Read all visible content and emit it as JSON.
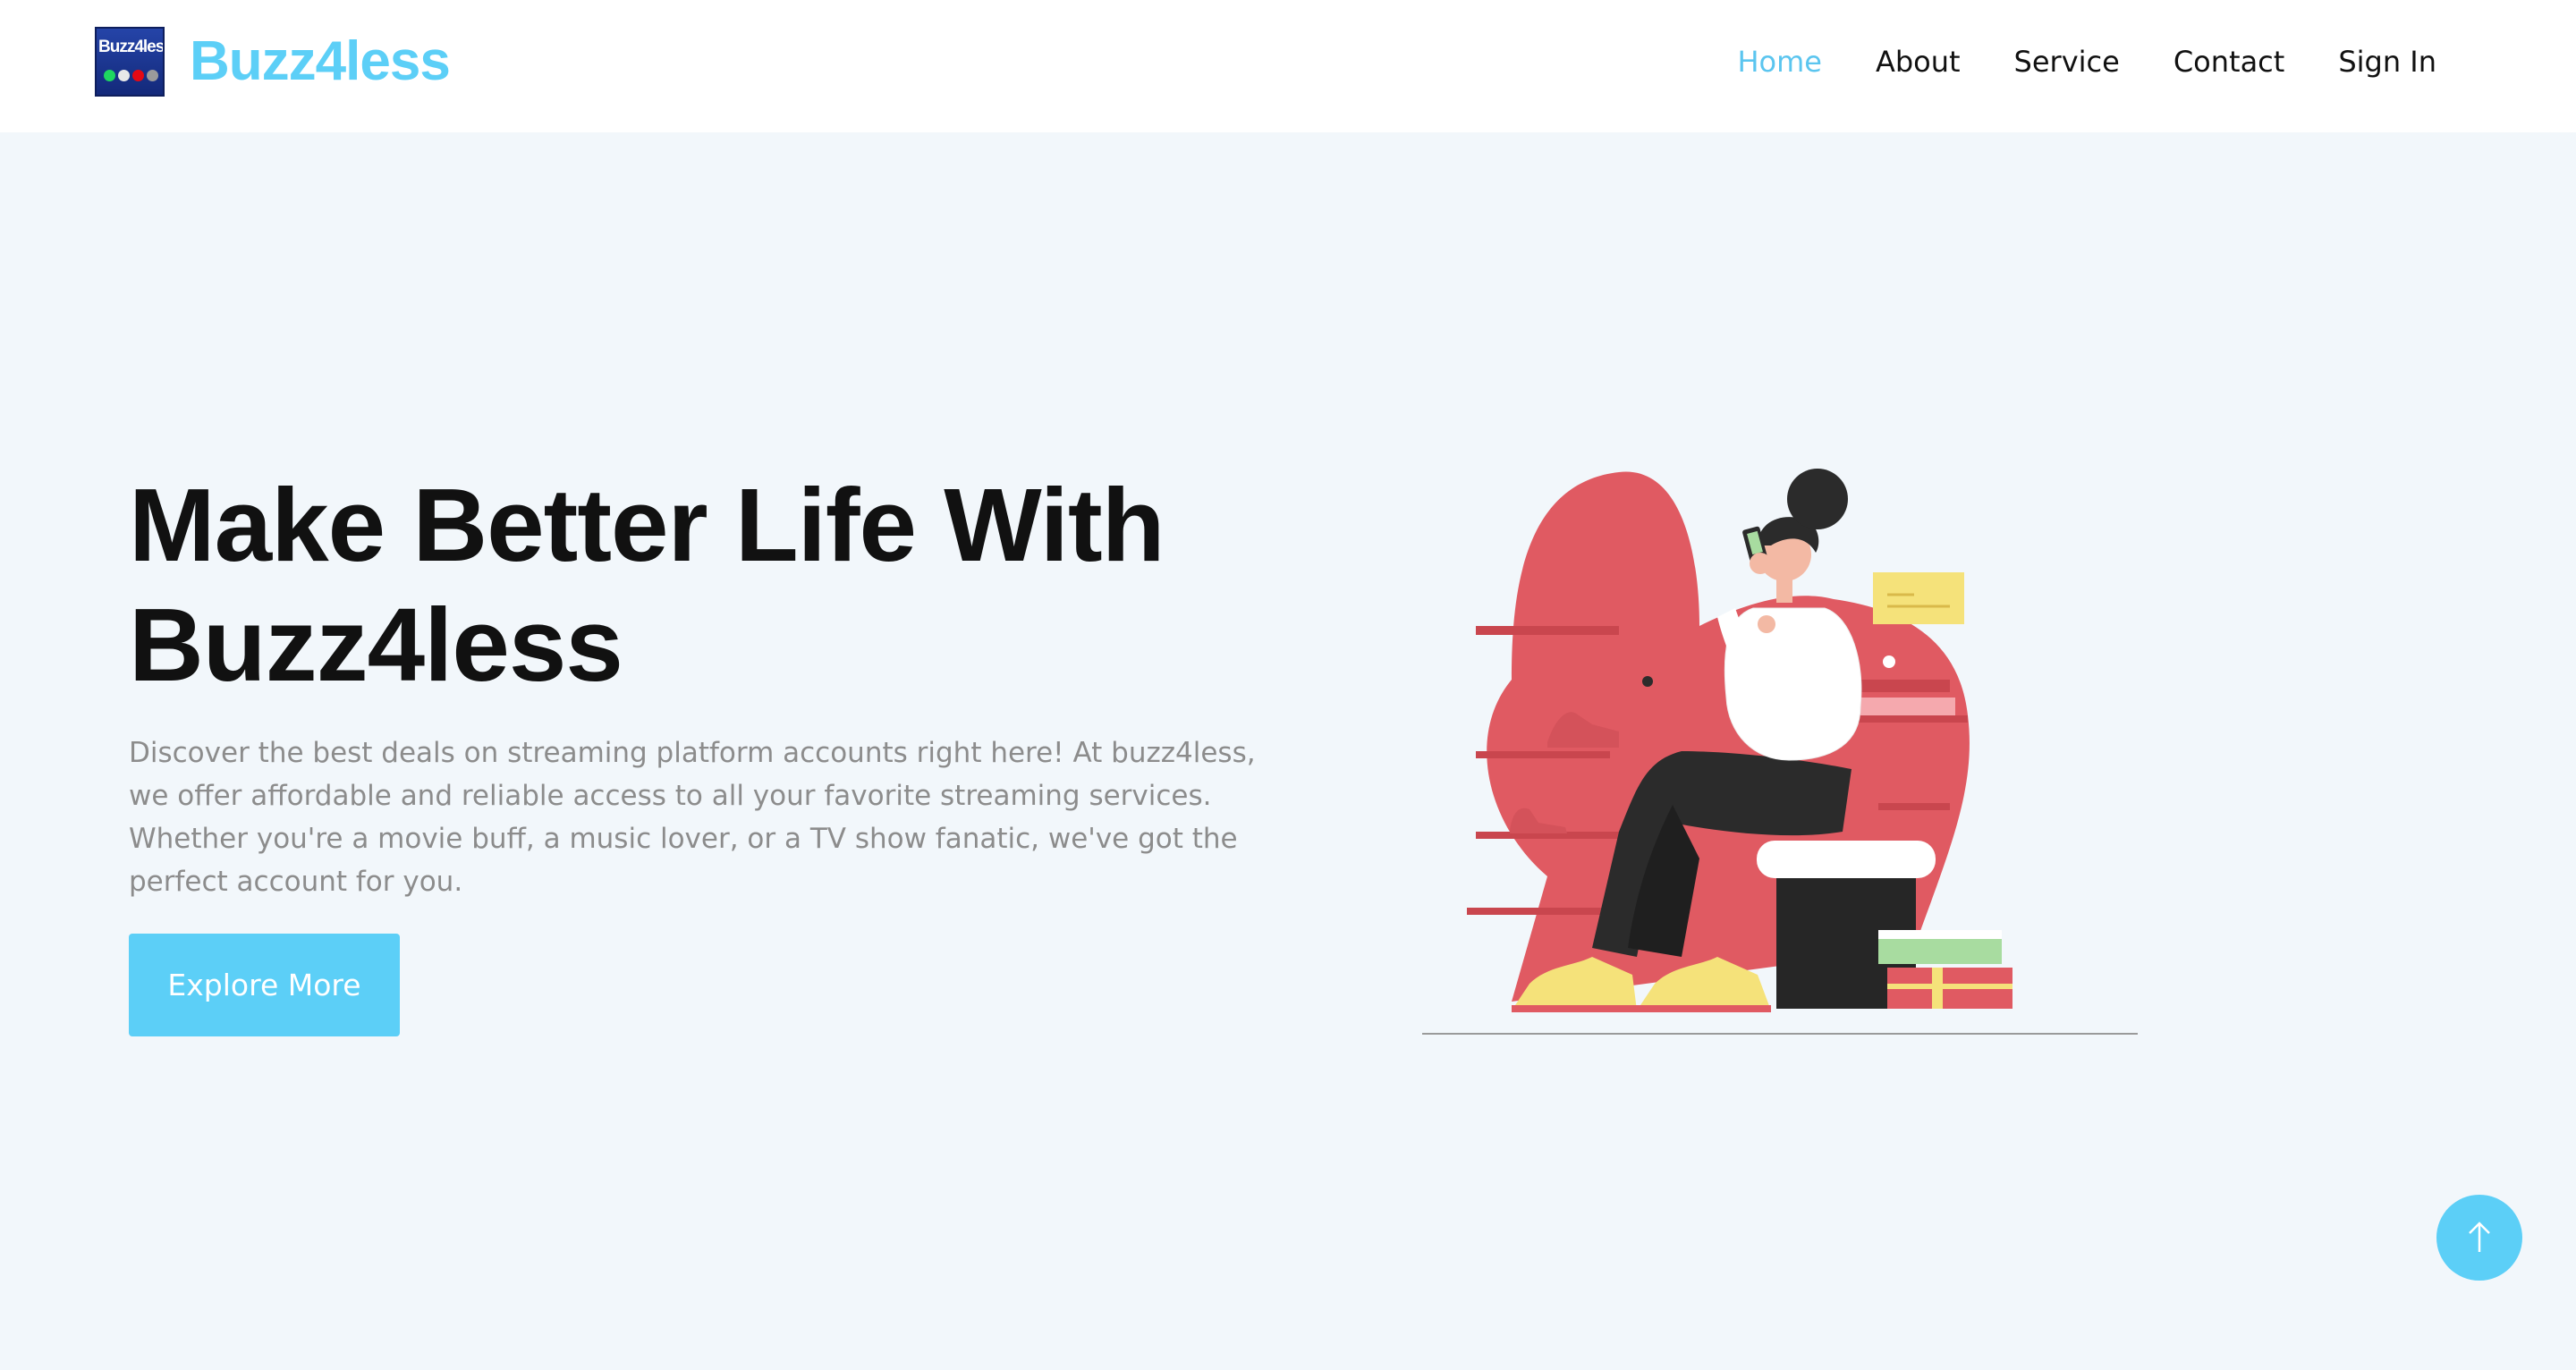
{
  "brand": {
    "logo_text": "Buzz4less",
    "name": "Buzz4less"
  },
  "nav": {
    "items": [
      {
        "label": "Home",
        "active": true
      },
      {
        "label": "About",
        "active": false
      },
      {
        "label": "Service",
        "active": false
      },
      {
        "label": "Contact",
        "active": false
      },
      {
        "label": "Sign In",
        "active": false
      }
    ]
  },
  "hero": {
    "title_line1": "Make Better Life With",
    "title_line2": "Buzz4less",
    "description": "Discover the best deals on streaming platform accounts right here! At buzz4less, we offer affordable and reliable access to all your favorite streaming services. Whether you're a movie buff, a music lover, or a TV show fanatic, we've got the perfect account for you.",
    "cta_label": "Explore More"
  },
  "icons": {
    "back_to_top": "arrow-up-icon"
  },
  "colors": {
    "accent": "#5ccff7",
    "nav_active": "#5bc5ef",
    "hero_background": "#f2f7fb",
    "title_text": "#111111",
    "body_text": "#8c8c8c",
    "illustration_blob": "#e05a62"
  }
}
